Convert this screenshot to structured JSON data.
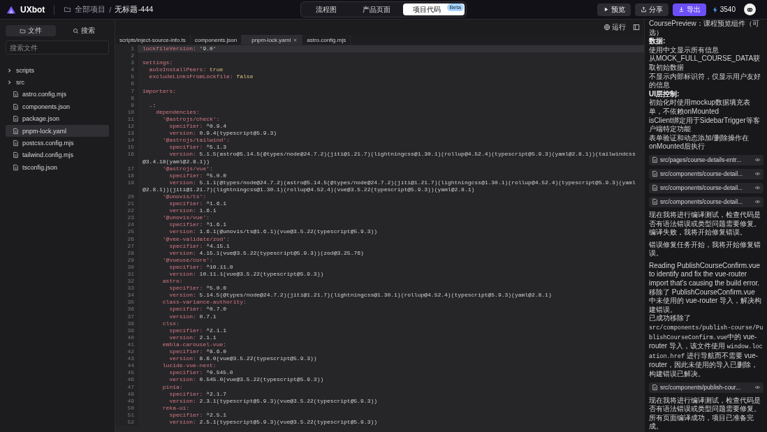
{
  "topbar": {
    "logo": "UXbot",
    "breadcrumb": {
      "root": "全部项目",
      "separator": "/",
      "title": "无标题-444"
    },
    "view_tabs": [
      {
        "label": "流程图",
        "selected": false
      },
      {
        "label": "产品页面",
        "selected": false
      },
      {
        "label": "项目代码",
        "selected": true,
        "badge": "Beta"
      }
    ],
    "actions": [
      {
        "kind": "preview",
        "label": "预览",
        "primary": false
      },
      {
        "kind": "share",
        "label": "分享",
        "primary": false
      },
      {
        "kind": "export",
        "label": "导出",
        "primary": true
      }
    ],
    "credits": "3540"
  },
  "sidebar": {
    "tabs": [
      {
        "kind": "files",
        "label": "文件",
        "selected": true
      },
      {
        "kind": "search",
        "label": "搜索",
        "selected": false
      }
    ],
    "search": {
      "placeholder": "搜索文件"
    },
    "tree": [
      {
        "kind": "folder",
        "name": "scripts",
        "expanded": false,
        "selected": false
      },
      {
        "kind": "folder",
        "name": "src",
        "expanded": false,
        "selected": false
      },
      {
        "kind": "file",
        "name": "astro.config.mjs",
        "selected": false
      },
      {
        "kind": "file",
        "name": "components.json",
        "selected": false
      },
      {
        "kind": "file",
        "name": "package.json",
        "selected": false
      },
      {
        "kind": "file",
        "name": "pnpm-lock.yaml",
        "selected": true
      },
      {
        "kind": "file",
        "name": "postcss.config.mjs",
        "selected": false
      },
      {
        "kind": "file",
        "name": "tailwind.config.mjs",
        "selected": false
      },
      {
        "kind": "file",
        "name": "tsconfig.json",
        "selected": false
      }
    ]
  },
  "editor": {
    "run_label": "运行",
    "tabs": [
      {
        "label": "scripts/inject-source-info.ts",
        "selected": false
      },
      {
        "label": "components.json",
        "selected": false
      },
      {
        "label": "pnpm-lock.yaml",
        "selected": true
      },
      {
        "label": "astro.config.mjs",
        "selected": false
      }
    ],
    "lines": [
      {
        "number": "1",
        "kind": "pair",
        "key": "lockfileVersion:",
        "value": " '9.0'",
        "current": true
      },
      {
        "number": "2",
        "kind": "blank",
        "current": false
      },
      {
        "number": "3",
        "kind": "key",
        "key": "settings:",
        "current": false
      },
      {
        "number": "4",
        "kind": "flag",
        "key": "  autoInstallPeers:",
        "value": " true",
        "current": false
      },
      {
        "number": "5",
        "kind": "flag",
        "key": "  excludeLinksFromLockfile:",
        "value": " false",
        "current": false
      },
      {
        "number": "6",
        "kind": "blank",
        "current": false
      },
      {
        "number": "7",
        "kind": "key",
        "key": "importers:",
        "current": false
      },
      {
        "number": "8",
        "kind": "blank",
        "current": false
      },
      {
        "number": "9",
        "kind": "plain",
        "key": "  .:",
        "current": false
      },
      {
        "number": "10",
        "kind": "key",
        "key": "    dependencies:",
        "current": false
      },
      {
        "number": "11",
        "kind": "key",
        "key": "      '@astrojs/check':",
        "current": false
      },
      {
        "number": "12",
        "kind": "pair",
        "key": "        specifier:",
        "value": " ^0.9.4",
        "current": false
      },
      {
        "number": "13",
        "kind": "pair",
        "key": "        version:",
        "value": " 0.9.4(typescript@5.9.3)",
        "current": false
      },
      {
        "number": "14",
        "kind": "key",
        "key": "      '@astrojs/tailwind':",
        "current": false
      },
      {
        "number": "15",
        "kind": "pair",
        "key": "        specifier:",
        "value": " ^5.1.3",
        "current": false
      },
      {
        "number": "16",
        "kind": "pair",
        "key": "        version:",
        "value": " 5.1.5(astro@5.14.5(@types/node@24.7.2)(jiti@1.21.7)(lightningcss@1.30.1)(rollup@4.52.4)(typescript@5.9.3)(yaml@2.8.1))(tailwindcss@3.4.18(yaml@2.8.1))",
        "current": false
      },
      {
        "number": "17",
        "kind": "key",
        "key": "      '@astrojs/vue':",
        "current": false
      },
      {
        "number": "18",
        "kind": "pair",
        "key": "        specifier:",
        "value": " ^5.0.0",
        "current": false
      },
      {
        "number": "19",
        "kind": "pair",
        "key": "        version:",
        "value": " 5.1.1(@types/node@24.7.2)(astro@5.14.5(@types/node@24.7.2)(jiti@1.21.7)(lightningcss@1.30.1)(rollup@4.52.4)(typescript@5.9.3)(yaml@2.8.1))(jiti@1.21.7)(lightningcss@1.30.1)(rollup@4.52.4)(vue@3.5.22(typescript@5.9.3))(yaml@2.8.1)",
        "current": false
      },
      {
        "number": "20",
        "kind": "key",
        "key": "      '@unovis/ts':",
        "current": false
      },
      {
        "number": "21",
        "kind": "pair",
        "key": "        specifier:",
        "value": " ^1.6.1",
        "current": false
      },
      {
        "number": "22",
        "kind": "pair",
        "key": "        version:",
        "value": " 1.6.1",
        "current": false
      },
      {
        "number": "23",
        "kind": "key",
        "key": "      '@unovis/vue':",
        "current": false
      },
      {
        "number": "24",
        "kind": "pair",
        "key": "        specifier:",
        "value": " ^1.6.1",
        "current": false
      },
      {
        "number": "25",
        "kind": "pair",
        "key": "        version:",
        "value": " 1.6.1(@unovis/ts@1.6.1)(vue@3.5.22(typescript@5.9.3))",
        "current": false
      },
      {
        "number": "26",
        "kind": "key",
        "key": "      '@vee-validate/zod':",
        "current": false
      },
      {
        "number": "27",
        "kind": "pair",
        "key": "        specifier:",
        "value": " ^4.15.1",
        "current": false
      },
      {
        "number": "28",
        "kind": "pair",
        "key": "        version:",
        "value": " 4.15.1(vue@3.5.22(typescript@5.9.3))(zod@3.25.76)",
        "current": false
      },
      {
        "number": "29",
        "kind": "key",
        "key": "      '@vueuse/core':",
        "current": false
      },
      {
        "number": "30",
        "kind": "pair",
        "key": "        specifier:",
        "value": " ^10.11.0",
        "current": false
      },
      {
        "number": "31",
        "kind": "pair",
        "key": "        version:",
        "value": " 10.11.1(vue@3.5.22(typescript@5.9.3))",
        "current": false
      },
      {
        "number": "32",
        "kind": "key",
        "key": "      astro:",
        "current": false
      },
      {
        "number": "33",
        "kind": "pair",
        "key": "        specifier:",
        "value": " ^5.0.0",
        "current": false
      },
      {
        "number": "34",
        "kind": "pair",
        "key": "        version:",
        "value": " 5.14.5(@types/node@24.7.2)(jiti@1.21.7)(lightningcss@1.30.1)(rollup@4.52.4)(typescript@5.9.3)(yaml@2.8.1)",
        "current": false
      },
      {
        "number": "35",
        "kind": "key",
        "key": "      class-variance-authority:",
        "current": false
      },
      {
        "number": "36",
        "kind": "pair",
        "key": "        specifier:",
        "value": " ^0.7.0",
        "current": false
      },
      {
        "number": "37",
        "kind": "pair",
        "key": "        version:",
        "value": " 0.7.1",
        "current": false
      },
      {
        "number": "38",
        "kind": "key",
        "key": "      clsx:",
        "current": false
      },
      {
        "number": "39",
        "kind": "pair",
        "key": "        specifier:",
        "value": " ^2.1.1",
        "current": false
      },
      {
        "number": "40",
        "kind": "pair",
        "key": "        version:",
        "value": " 2.1.1",
        "current": false
      },
      {
        "number": "41",
        "kind": "key",
        "key": "      embla-carousel-vue:",
        "current": false
      },
      {
        "number": "42",
        "kind": "pair",
        "key": "        specifier:",
        "value": " ^8.6.0",
        "current": false
      },
      {
        "number": "43",
        "kind": "pair",
        "key": "        version:",
        "value": " 8.6.0(vue@3.5.22(typescript@5.9.3))",
        "current": false
      },
      {
        "number": "44",
        "kind": "key",
        "key": "      lucide-vue-next:",
        "current": false
      },
      {
        "number": "45",
        "kind": "pair",
        "key": "        specifier:",
        "value": " ^0.545.0",
        "current": false
      },
      {
        "number": "46",
        "kind": "pair",
        "key": "        version:",
        "value": " 0.545.0(vue@3.5.22(typescript@5.9.3))",
        "current": false
      },
      {
        "number": "47",
        "kind": "key",
        "key": "      pinia:",
        "current": false
      },
      {
        "number": "48",
        "kind": "pair",
        "key": "        specifier:",
        "value": " ^2.1.7",
        "current": false
      },
      {
        "number": "49",
        "kind": "pair",
        "key": "        version:",
        "value": " 2.3.1(typescript@5.9.3)(vue@3.5.22(typescript@5.9.3))",
        "current": false
      },
      {
        "number": "50",
        "kind": "key",
        "key": "      reka-ui:",
        "current": false
      },
      {
        "number": "51",
        "kind": "pair",
        "key": "        specifier:",
        "value": " ^2.5.1",
        "current": false
      },
      {
        "number": "52",
        "kind": "pair",
        "key": "        version:",
        "value": " 2.5.1(typescript@5.9.3)(vue@3.5.22(typescript@5.9.3))",
        "current": false
      }
    ]
  },
  "chat": [
    {
      "kind": "text",
      "lines": [
        {
          "kind": "plain",
          "text": "CoursePreview：课程预览组件（可选）"
        },
        {
          "kind": "heading",
          "text": "数据:"
        },
        {
          "kind": "plain",
          "text": "使用中文显示所有信息"
        },
        {
          "kind": "plain",
          "text": "从MOCK_FULL_COURSE_DATA获取初始数据"
        },
        {
          "kind": "plain",
          "text": "不显示内部标识符，仅显示用户友好的信息"
        },
        {
          "kind": "heading",
          "text": "UI层控制:"
        },
        {
          "kind": "plain",
          "text": "初始化时使用mockup数据填充表单，不依赖onMounted"
        },
        {
          "kind": "plain",
          "text": "isClient绑定用于SidebarTrigger等客户端特定功能"
        },
        {
          "kind": "plain",
          "text": "表单验证和动态添加/删除操作在onMounted后执行"
        }
      ]
    },
    {
      "kind": "file",
      "path": "src/pages/course-details-entr..."
    },
    {
      "kind": "file",
      "path": "src/components/course-detail..."
    },
    {
      "kind": "file",
      "path": "src/components/course-detail..."
    },
    {
      "kind": "file",
      "path": "src/components/course-detail..."
    },
    {
      "kind": "text",
      "lines": [
        {
          "kind": "plain",
          "text": "现在我将进行编译测试，检查代码是否有语法错误或类型问题需要修复。"
        },
        {
          "kind": "plain",
          "text": "编译失败，我将开始修复错误。"
        }
      ]
    },
    {
      "kind": "text",
      "lines": [
        {
          "kind": "plain",
          "text": "错误修复任务开始，我将开始修复错误。"
        }
      ]
    },
    {
      "kind": "text",
      "lines": [
        {
          "kind": "plain",
          "text": "Reading PublishCourseConfirm.vue to identify and fix the vue-router import that's causing the build error."
        },
        {
          "kind": "plain",
          "text": "移除了 PublishCourseConfirm.vue 中未使用的 vue-router 导入，解决构建错误。"
        },
        {
          "kind": "plain",
          "text": "已成功移除了"
        },
        {
          "kind": "mixed",
          "parts": [
            {
              "text": "src/components/publish-course/PublishCourseConfirm.vue",
              "code": true
            },
            {
              "text": "中的 vue-router 导入，该文件使用 ",
              "code": false
            },
            {
              "text": "window.location.href",
              "code": true
            },
            {
              "text": " 进行导航而不需要 vue-router，因此未使用的导入已删除，构建错误已解决。",
              "code": false
            }
          ]
        }
      ]
    },
    {
      "kind": "file",
      "path": "src/components/publish-cour..."
    },
    {
      "kind": "text",
      "lines": [
        {
          "kind": "plain",
          "text": "现在我将进行编译测试，检查代码是否有语法错误或类型问题需要修复。"
        },
        {
          "kind": "plain",
          "text": "所有页面编译成功，项目已准备完成。"
        }
      ]
    }
  ]
}
